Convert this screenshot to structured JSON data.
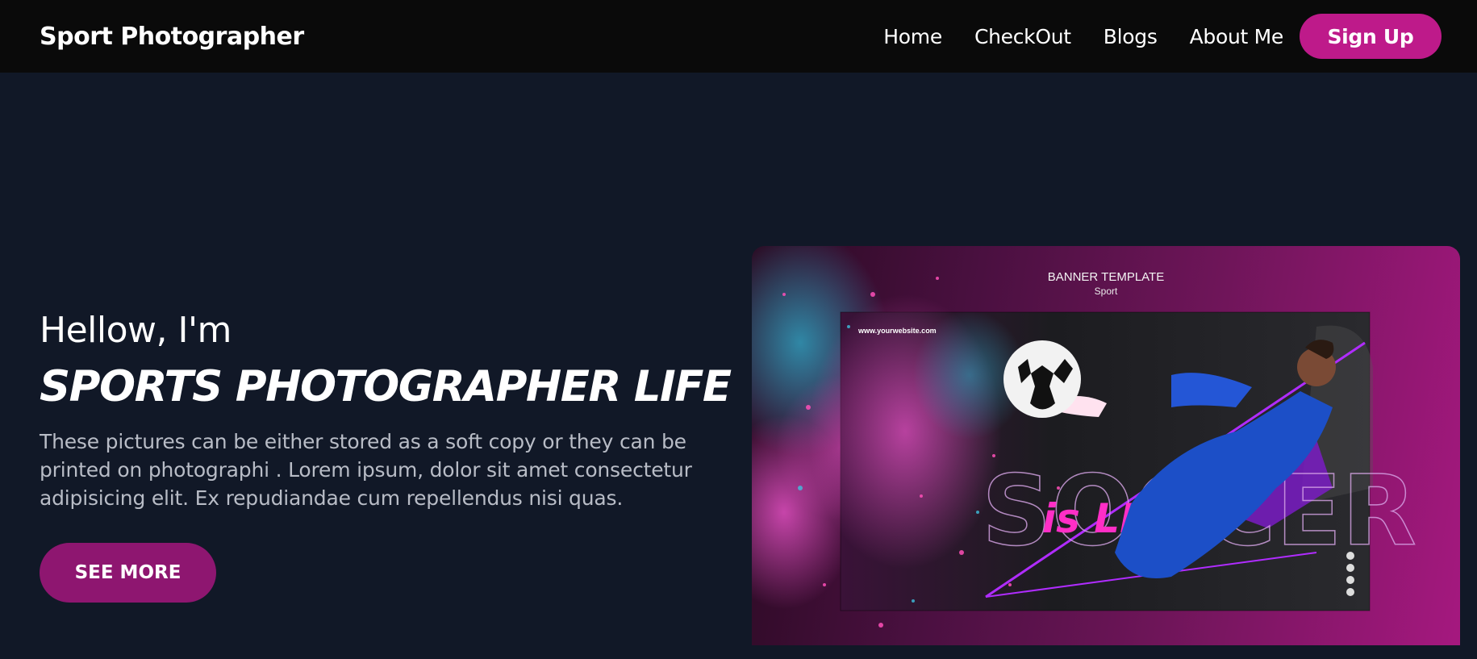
{
  "navbar": {
    "brand": "Sport Photographer",
    "links": [
      "Home",
      "CheckOut",
      "Blogs",
      "About Me"
    ],
    "signup_label": "Sign Up"
  },
  "hero": {
    "greeting": "Hellow, I'm",
    "headline": "SPORTS PHOTOGRAPHER LIFE",
    "description": "These pictures can be either stored as a soft copy or they can be printed on photographi . Lorem ipsum, dolor sit amet consectetur adipisicing elit. Ex repudiandae cum repellendus nisi quas.",
    "cta_label": "SEE MORE"
  },
  "hero_image": {
    "banner_title": "BANNER TEMPLATE",
    "banner_subtitle": "Sport",
    "banner_url": "www.yourwebsite.com",
    "word_1": "SOCCER",
    "word_2": "is LIFE"
  },
  "colors": {
    "navbar_bg": "#0a0a0a",
    "page_bg": "#111827",
    "accent": "#be1a8a",
    "cta_bg": "#8e1670"
  }
}
